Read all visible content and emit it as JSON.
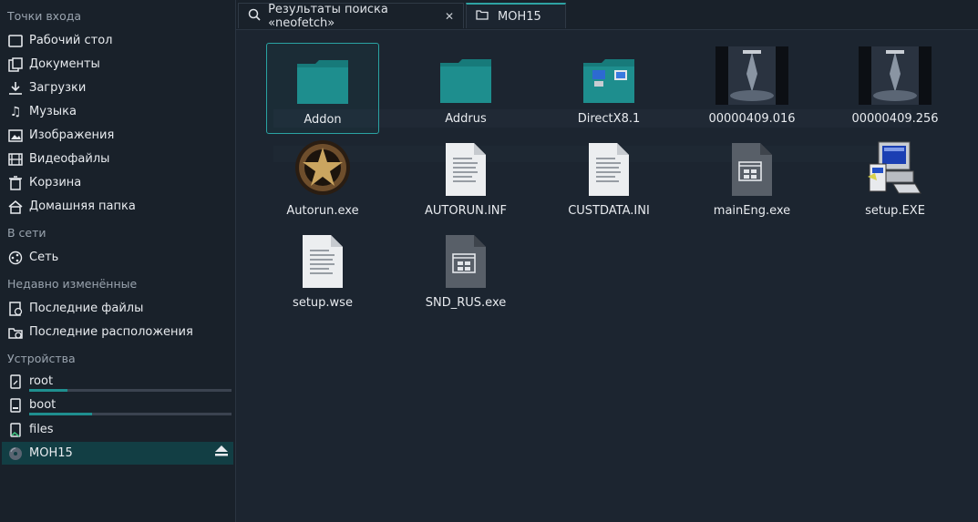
{
  "sidebar": {
    "places_title": "Точки входа",
    "places": [
      {
        "label": "Рабочий стол",
        "icon": "desktop-icon"
      },
      {
        "label": "Документы",
        "icon": "documents-icon"
      },
      {
        "label": "Загрузки",
        "icon": "downloads-icon"
      },
      {
        "label": "Музыка",
        "icon": "music-icon"
      },
      {
        "label": "Изображения",
        "icon": "pictures-icon"
      },
      {
        "label": "Видеофайлы",
        "icon": "videos-icon"
      },
      {
        "label": "Корзина",
        "icon": "trash-icon"
      },
      {
        "label": "Домашняя папка",
        "icon": "home-icon"
      }
    ],
    "network_title": "В сети",
    "network": [
      {
        "label": "Сеть",
        "icon": "network-icon"
      }
    ],
    "recent_title": "Недавно изменённые",
    "recent": [
      {
        "label": "Последние файлы",
        "icon": "recent-files-icon"
      },
      {
        "label": "Последние расположения",
        "icon": "recent-locations-icon"
      }
    ],
    "devices_title": "Устройства",
    "devices": [
      {
        "label": "root",
        "icon": "drive-icon",
        "usage": 0.19
      },
      {
        "label": "boot",
        "icon": "drive-icon",
        "usage": 0.31
      },
      {
        "label": "files",
        "icon": "drive-icon"
      },
      {
        "label": "MOH15",
        "icon": "optical-disc-icon"
      }
    ]
  },
  "tabs": [
    {
      "label": "Результаты поиска «neofetch»",
      "icon": "search-icon"
    },
    {
      "label": "MOH15",
      "icon": "folder-icon"
    }
  ],
  "files": [
    {
      "name": "Addon",
      "type": "folder"
    },
    {
      "name": "Addrus",
      "type": "folder"
    },
    {
      "name": "DirectX8.1",
      "type": "folder"
    },
    {
      "name": "00000409.016",
      "type": "image"
    },
    {
      "name": "00000409.256",
      "type": "image"
    },
    {
      "name": "Autorun.exe",
      "type": "exe-emblem"
    },
    {
      "name": "AUTORUN.INF",
      "type": "text"
    },
    {
      "name": "CUSTDATA.INI",
      "type": "text"
    },
    {
      "name": "mainEng.exe",
      "type": "exe"
    },
    {
      "name": "setup.EXE",
      "type": "setup"
    },
    {
      "name": "setup.wse",
      "type": "text"
    },
    {
      "name": "SND_RUS.exe",
      "type": "exe"
    }
  ],
  "colors": {
    "accent": "#2aa3a3",
    "folder": "#1e8e8e",
    "background": "#1c2530"
  }
}
